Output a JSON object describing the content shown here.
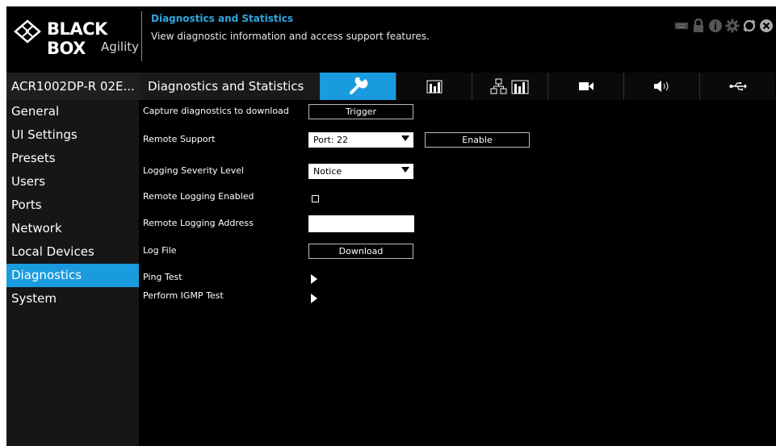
{
  "brand": {
    "name": "BLACK BOX",
    "product": "Agility"
  },
  "header": {
    "title": "Diagnostics and Statistics",
    "subtitle": "View diagnostic information and access support features.",
    "icons": [
      "keyboard-icon",
      "lock-icon",
      "info-icon",
      "gear-icon",
      "refresh-icon",
      "close-icon"
    ]
  },
  "device_name": "ACR1002DP-R 02E...",
  "section_title": "Diagnostics and Statistics",
  "tabs": [
    {
      "icon": "wrench-icon",
      "active": true
    },
    {
      "icon": "bar-chart-icon",
      "active": false
    },
    {
      "icon": "network-stats-icon",
      "active": false
    },
    {
      "icon": "video-icon",
      "active": false
    },
    {
      "icon": "speaker-icon",
      "active": false
    },
    {
      "icon": "usb-icon",
      "active": false
    }
  ],
  "sidebar": {
    "items": [
      {
        "label": "General"
      },
      {
        "label": "UI Settings"
      },
      {
        "label": "Presets"
      },
      {
        "label": "Users"
      },
      {
        "label": "Ports"
      },
      {
        "label": "Network"
      },
      {
        "label": "Local Devices"
      },
      {
        "label": "Diagnostics",
        "active": true
      },
      {
        "label": "System"
      }
    ]
  },
  "form": {
    "capture_label": "Capture diagnostics to download",
    "trigger_button": "Trigger",
    "remote_support_label": "Remote Support",
    "port_value": "Port: 22",
    "enable_button": "Enable",
    "logging_severity_label": "Logging Severity Level",
    "logging_severity_value": "Notice",
    "remote_logging_enabled_label": "Remote Logging Enabled",
    "remote_logging_enabled": false,
    "remote_logging_address_label": "Remote Logging Address",
    "remote_logging_address_value": "",
    "log_file_label": "Log File",
    "download_button": "Download",
    "ping_test_label": "Ping Test",
    "igmp_test_label": "Perform IGMP Test"
  },
  "colors": {
    "accent": "#1a9bde",
    "title_blue": "#2fa8e0",
    "background": "#000000",
    "sidebar": "#161616"
  }
}
